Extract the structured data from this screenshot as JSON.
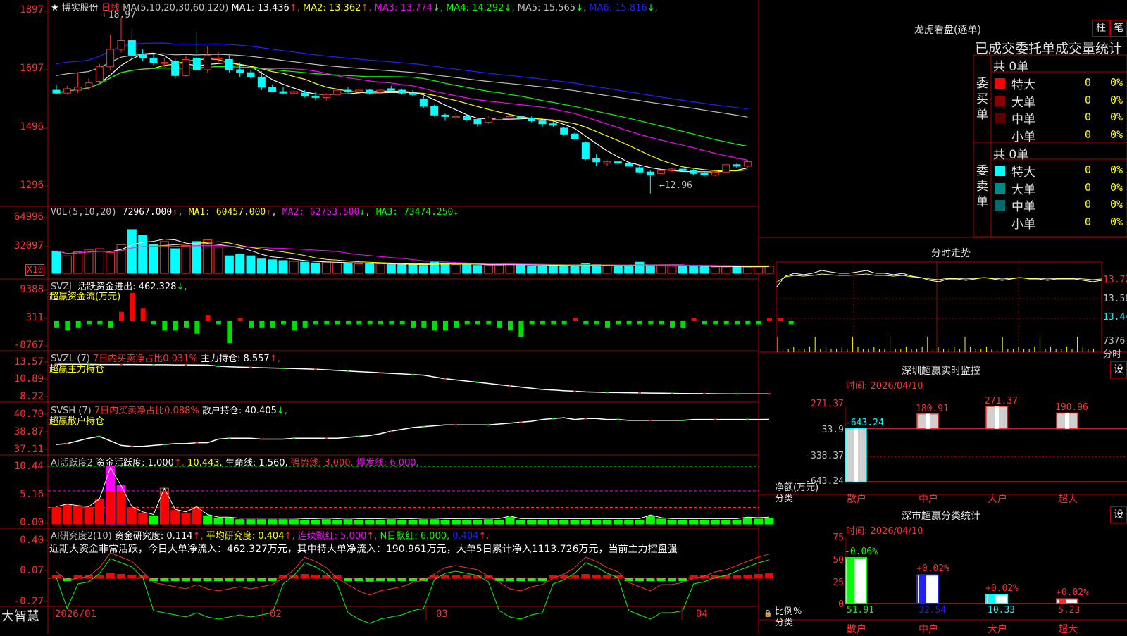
{
  "stock": {
    "name": "博实股份",
    "period": "日线",
    "ma_params": "MA(5,10,20,30,60,120)",
    "ma_values": [
      {
        "label": "MA1: 13.436",
        "arrow": "↑",
        "color": "#ffffff"
      },
      {
        "label": "MA2: 13.362",
        "arrow": "↑",
        "color": "#ffff00"
      },
      {
        "label": "MA3: 13.774",
        "arrow": "↓",
        "color": "#ff00ff"
      },
      {
        "label": "MA4: 14.292",
        "arrow": "↓",
        "color": "#00ff00"
      },
      {
        "label": "MA5: 15.565",
        "arrow": "↓",
        "color": "#c0c0c0"
      },
      {
        "label": "MA6: 15.816",
        "arrow": "↓",
        "color": "#2020ff"
      }
    ],
    "high_mark": "18.97",
    "low_mark": "12.96",
    "price_axis": [
      "1897",
      "1697",
      "1496",
      "1296"
    ]
  },
  "chart_data": [
    {
      "type": "candlestick",
      "title": "日线",
      "ylim": [
        12.5,
        19.2
      ],
      "candles": [
        {
          "o": 16.5,
          "h": 16.7,
          "l": 16.4,
          "c": 16.4
        },
        {
          "o": 16.4,
          "h": 16.65,
          "l": 16.35,
          "c": 16.55
        },
        {
          "o": 16.5,
          "h": 17.1,
          "l": 16.4,
          "c": 16.6
        },
        {
          "o": 16.6,
          "h": 16.9,
          "l": 16.5,
          "c": 16.75
        },
        {
          "o": 16.8,
          "h": 17.4,
          "l": 16.7,
          "c": 17.3
        },
        {
          "o": 17.3,
          "h": 18.4,
          "l": 17.2,
          "c": 17.9
        },
        {
          "o": 17.9,
          "h": 18.97,
          "l": 17.8,
          "c": 18.2
        },
        {
          "o": 18.2,
          "h": 18.6,
          "l": 17.6,
          "c": 17.7
        },
        {
          "o": 17.7,
          "h": 17.9,
          "l": 17.5,
          "c": 17.6
        },
        {
          "o": 17.6,
          "h": 17.75,
          "l": 17.35,
          "c": 17.45
        },
        {
          "o": 17.45,
          "h": 17.6,
          "l": 17.3,
          "c": 17.45
        },
        {
          "o": 17.5,
          "h": 17.6,
          "l": 16.9,
          "c": 17.0
        },
        {
          "o": 17.0,
          "h": 17.7,
          "l": 16.95,
          "c": 17.55
        },
        {
          "o": 17.6,
          "h": 18.5,
          "l": 17.5,
          "c": 17.2
        },
        {
          "o": 17.2,
          "h": 18.0,
          "l": 17.1,
          "c": 17.7
        },
        {
          "o": 17.6,
          "h": 17.8,
          "l": 17.4,
          "c": 17.6
        },
        {
          "o": 17.55,
          "h": 17.7,
          "l": 17.1,
          "c": 17.2
        },
        {
          "o": 17.2,
          "h": 17.45,
          "l": 16.95,
          "c": 17.1
        },
        {
          "o": 17.1,
          "h": 17.2,
          "l": 16.9,
          "c": 16.95
        },
        {
          "o": 16.95,
          "h": 17.15,
          "l": 16.5,
          "c": 16.6
        },
        {
          "o": 16.6,
          "h": 16.7,
          "l": 16.45,
          "c": 16.45
        },
        {
          "o": 16.45,
          "h": 16.6,
          "l": 16.35,
          "c": 16.4
        },
        {
          "o": 16.4,
          "h": 16.55,
          "l": 16.35,
          "c": 16.45
        },
        {
          "o": 16.4,
          "h": 16.5,
          "l": 16.25,
          "c": 16.3
        },
        {
          "o": 16.3,
          "h": 16.45,
          "l": 16.15,
          "c": 16.25
        },
        {
          "o": 16.25,
          "h": 16.4,
          "l": 16.15,
          "c": 16.35
        },
        {
          "o": 16.35,
          "h": 16.55,
          "l": 16.3,
          "c": 16.5
        },
        {
          "o": 16.5,
          "h": 16.6,
          "l": 16.4,
          "c": 16.45
        },
        {
          "o": 16.45,
          "h": 16.6,
          "l": 16.4,
          "c": 16.5
        },
        {
          "o": 16.5,
          "h": 16.55,
          "l": 16.35,
          "c": 16.4
        },
        {
          "o": 16.45,
          "h": 16.55,
          "l": 16.4,
          "c": 16.5
        },
        {
          "o": 16.55,
          "h": 16.65,
          "l": 16.45,
          "c": 16.5
        },
        {
          "o": 16.5,
          "h": 16.55,
          "l": 16.35,
          "c": 16.4
        },
        {
          "o": 16.4,
          "h": 16.5,
          "l": 16.3,
          "c": 16.35
        },
        {
          "o": 16.2,
          "h": 16.3,
          "l": 15.9,
          "c": 15.95
        },
        {
          "o": 15.95,
          "h": 16.0,
          "l": 15.6,
          "c": 15.65
        },
        {
          "o": 15.65,
          "h": 15.7,
          "l": 15.45,
          "c": 15.6
        },
        {
          "o": 15.6,
          "h": 15.7,
          "l": 15.5,
          "c": 15.6
        },
        {
          "o": 15.6,
          "h": 15.65,
          "l": 15.45,
          "c": 15.5
        },
        {
          "o": 15.5,
          "h": 15.55,
          "l": 15.25,
          "c": 15.35
        },
        {
          "o": 15.4,
          "h": 15.6,
          "l": 15.35,
          "c": 15.55
        },
        {
          "o": 15.5,
          "h": 15.6,
          "l": 15.45,
          "c": 15.55
        },
        {
          "o": 15.55,
          "h": 15.65,
          "l": 15.5,
          "c": 15.6
        },
        {
          "o": 15.6,
          "h": 15.65,
          "l": 15.5,
          "c": 15.55
        },
        {
          "o": 15.55,
          "h": 15.6,
          "l": 15.4,
          "c": 15.45
        },
        {
          "o": 15.45,
          "h": 15.5,
          "l": 15.25,
          "c": 15.35
        },
        {
          "o": 15.35,
          "h": 15.45,
          "l": 15.25,
          "c": 15.3
        },
        {
          "o": 15.2,
          "h": 15.25,
          "l": 14.95,
          "c": 15.0
        },
        {
          "o": 15.0,
          "h": 15.05,
          "l": 14.8,
          "c": 14.85
        },
        {
          "o": 14.7,
          "h": 14.75,
          "l": 14.1,
          "c": 14.15
        },
        {
          "o": 14.15,
          "h": 14.3,
          "l": 13.9,
          "c": 14.05
        },
        {
          "o": 14.0,
          "h": 14.1,
          "l": 13.9,
          "c": 14.05
        },
        {
          "o": 14.05,
          "h": 14.1,
          "l": 13.95,
          "c": 14.0
        },
        {
          "o": 14.0,
          "h": 14.05,
          "l": 13.9,
          "c": 13.9
        },
        {
          "o": 13.85,
          "h": 13.9,
          "l": 13.65,
          "c": 13.7
        },
        {
          "o": 13.7,
          "h": 13.75,
          "l": 12.96,
          "c": 13.6
        },
        {
          "o": 13.65,
          "h": 13.8,
          "l": 13.6,
          "c": 13.75
        },
        {
          "o": 13.75,
          "h": 13.85,
          "l": 13.7,
          "c": 13.8
        },
        {
          "o": 13.8,
          "h": 13.85,
          "l": 13.7,
          "c": 13.75
        },
        {
          "o": 13.75,
          "h": 13.8,
          "l": 13.6,
          "c": 13.65
        },
        {
          "o": 13.65,
          "h": 13.7,
          "l": 13.55,
          "c": 13.6
        },
        {
          "o": 13.6,
          "h": 13.75,
          "l": 13.55,
          "c": 13.7
        },
        {
          "o": 13.7,
          "h": 14.0,
          "l": 13.65,
          "c": 13.95
        },
        {
          "o": 13.95,
          "h": 14.0,
          "l": 13.85,
          "c": 13.9
        },
        {
          "o": 13.9,
          "h": 14.1,
          "l": 13.85,
          "c": 14.05
        }
      ]
    },
    {
      "type": "bar",
      "title": "VOL(5,10,20)",
      "series_labels": [
        "72967.000",
        "MA1: 60457.000",
        "MA2: 62753.500",
        "MA3: 73474.250"
      ],
      "values": [
        28,
        22,
        27,
        30,
        31,
        26,
        36,
        55,
        48,
        36,
        40,
        31,
        35,
        40,
        42,
        33,
        22,
        24,
        22,
        18,
        17,
        16,
        15,
        14,
        13,
        14,
        13,
        13,
        12,
        12,
        12,
        11,
        11,
        11,
        10,
        14,
        13,
        11,
        11,
        10,
        10,
        11,
        13,
        10,
        9,
        9,
        10,
        9,
        9,
        12,
        11,
        10,
        9,
        10,
        14,
        10,
        10,
        9,
        9,
        9,
        9,
        8,
        8,
        8,
        8,
        9,
        9
      ],
      "ylim": [
        0,
        70
      ]
    },
    {
      "type": "bar",
      "title": "SVZJ 活跃资金进出",
      "value_label": "462.328",
      "values": [
        -2,
        -3,
        -2,
        -1,
        -1,
        -2,
        3,
        9,
        4,
        -1,
        -3,
        -3,
        -2,
        -4,
        2,
        -1,
        -7,
        1,
        -2,
        -2,
        -2,
        -1,
        -3,
        -2,
        -1,
        -1,
        -1,
        -1,
        -1,
        -1,
        -1,
        -1,
        -1,
        -2,
        -2,
        -3,
        -3,
        -2,
        -1,
        -1,
        -1,
        -2,
        -3,
        -5,
        -1,
        -1,
        -1,
        -1,
        1,
        -1,
        -1,
        -2,
        -1,
        -1,
        -1,
        -1,
        -1,
        -2,
        -2,
        1,
        -1,
        -1,
        -1,
        -1,
        -1,
        -1,
        1,
        1,
        -1
      ],
      "ylim": [
        -9,
        9
      ]
    },
    {
      "type": "line",
      "title": "SVZL (7)",
      "values": [
        13.52,
        13.52,
        13.5,
        13.5,
        13.48,
        13.48,
        13.47,
        13.47,
        13.46,
        13.44,
        13.44,
        13.42,
        13.42,
        13.4,
        13.38,
        13.2,
        13.1,
        13.05,
        13.0,
        12.95,
        12.9,
        12.85,
        12.8,
        12.75,
        12.7,
        12.6,
        12.5,
        12.4,
        12.3,
        12.2,
        12.1,
        12.0,
        11.9,
        11.8,
        11.7,
        11.4,
        11.1,
        10.9,
        10.7,
        10.5,
        10.3,
        10.1,
        9.9,
        9.7,
        9.5,
        9.3,
        9.2,
        9.1,
        9.0,
        8.9,
        8.85,
        8.8,
        8.78,
        8.75,
        8.72,
        8.7,
        8.68,
        8.65,
        8.63,
        8.6,
        8.6,
        8.58,
        8.57,
        8.56,
        8.56,
        8.56,
        8.557
      ],
      "ylim": [
        8.0,
        13.9
      ]
    },
    {
      "type": "line",
      "title": "SVSH (7)",
      "values": [
        37.6,
        37.7,
        38.0,
        38.3,
        38.5,
        38.0,
        37.5,
        37.4,
        37.4,
        37.5,
        37.6,
        37.7,
        37.7,
        37.8,
        37.8,
        38.2,
        38.3,
        38.3,
        38.3,
        38.2,
        38.2,
        38.2,
        38.3,
        38.3,
        38.3,
        38.3,
        38.3,
        38.4,
        38.5,
        38.6,
        38.8,
        39.1,
        39.3,
        39.5,
        39.6,
        39.7,
        39.8,
        39.8,
        39.8,
        39.8,
        39.8,
        39.9,
        40.0,
        40.1,
        40.2,
        40.4,
        40.5,
        40.6,
        40.4,
        40.5,
        40.5,
        40.4,
        40.4,
        40.3,
        40.3,
        40.3,
        40.3,
        40.3,
        40.3,
        40.4,
        40.4,
        40.4,
        40.4,
        40.4,
        40.4,
        40.4,
        40.405
      ],
      "ylim": [
        36.9,
        41.0
      ]
    },
    {
      "type": "bar",
      "title": "AI活跃度2",
      "values": [
        3.0,
        3.5,
        3.2,
        3.0,
        4.5,
        10.44,
        7.0,
        3.0,
        2.0,
        1.5,
        6.5,
        2.5,
        2.0,
        3.0,
        1.5,
        1.0,
        1.0,
        0.8,
        0.8,
        0.8,
        0.8,
        0.8,
        0.8,
        0.7,
        0.7,
        0.8,
        0.7,
        0.8,
        0.7,
        0.7,
        0.7,
        0.8,
        0.7,
        0.7,
        0.8,
        0.8,
        0.7,
        0.7,
        0.7,
        0.7,
        0.8,
        0.7,
        1.2,
        0.7,
        0.7,
        0.7,
        0.7,
        0.7,
        0.7,
        0.7,
        0.7,
        0.7,
        0.7,
        0.7,
        0.7,
        1.4,
        0.9,
        0.7,
        0.7,
        0.7,
        0.7,
        0.7,
        0.7,
        0.7,
        1.0,
        0.9,
        1.0
      ],
      "ylim": [
        0,
        11.5
      ]
    },
    {
      "type": "bar",
      "title": "AI研究度2(10)",
      "values": [
        0.03,
        -0.01,
        0.0,
        0.01,
        0.05,
        0.12,
        0.1,
        0.08,
        0.03,
        -0.02,
        -0.03,
        -0.04,
        -0.05,
        -0.03,
        -0.05,
        -0.06,
        -0.05,
        -0.04,
        -0.05,
        -0.04,
        -0.03,
        0.0,
        0.04,
        0.1,
        0.08,
        0.05,
        0.0,
        -0.03,
        -0.06,
        -0.08,
        -0.06,
        -0.05,
        -0.04,
        -0.02,
        -0.01,
        0.02,
        0.05,
        0.06,
        0.05,
        0.04,
        0.01,
        -0.02,
        -0.05,
        -0.06,
        -0.04,
        -0.03,
        0.0,
        0.02,
        0.05,
        0.1,
        0.08,
        0.05,
        0.03,
        -0.02,
        -0.04,
        -0.06,
        -0.03,
        -0.03,
        -0.02,
        0.0,
        0.01,
        0.03,
        0.04,
        0.06,
        0.08,
        0.1,
        0.114
      ],
      "ylim": [
        -0.3,
        0.45
      ]
    },
    {
      "type": "line",
      "title": "分时走势",
      "values": [
        13.6,
        13.68,
        13.7,
        13.69,
        13.7,
        13.72,
        13.71,
        13.7,
        13.7,
        13.71,
        13.72,
        13.7,
        13.7,
        13.69,
        13.7,
        13.68,
        13.67,
        13.65,
        13.64,
        13.66,
        13.66,
        13.65,
        13.66,
        13.67,
        13.66,
        13.65,
        13.66,
        13.67,
        13.66,
        13.66,
        13.65,
        13.66,
        13.66,
        13.66,
        13.65,
        13.64,
        13.65
      ],
      "ylim": [
        13.38,
        13.78
      ]
    },
    {
      "type": "bar",
      "title": "深圳超赢实时监控",
      "categories": [
        "散户",
        "中户",
        "大户",
        "超大"
      ],
      "values": [
        -643.24,
        180.91,
        271.37,
        190.96
      ],
      "ylim": [
        -643.24,
        271.37
      ]
    },
    {
      "type": "bar",
      "title": "深市超赢分类统计",
      "categories": [
        "散户",
        "中户",
        "大户",
        "超大"
      ],
      "values": [
        51.91,
        32.54,
        10.33,
        5.23
      ],
      "changes": [
        "-0.06%",
        "+0.02%",
        "+0.02%",
        "+0.02%"
      ],
      "ylim": [
        0,
        75
      ]
    }
  ],
  "vol": {
    "params": "VOL(5,10,20)",
    "v": "72967.000",
    "v_arrow": "↑",
    "ma1": "MA1: 60457.000",
    "ma1_arrow": "↑",
    "ma2": "MA2: 62753.500",
    "ma2_arrow": "↓",
    "ma3": "MA3: 73474.250",
    "ma3_arrow": "↓",
    "axis": [
      "64996",
      "32097"
    ],
    "unit": "X10"
  },
  "svzj": {
    "title": "SVZJ",
    "label": "活跃资金进出: 462.328",
    "arrow": "↓",
    "sub": "超赢资金流(万元)",
    "axis": [
      "9388",
      "311",
      "-8767"
    ]
  },
  "svzl": {
    "title": "SVZL (7)",
    "red_label": "7日内买卖净占比0.031%",
    "label": "主力持仓: 8.557",
    "arrow": "↑,",
    "sub": "超赢主力持仓",
    "axis": [
      "13.57",
      "10.89",
      "8.22"
    ]
  },
  "svsh": {
    "title": "SVSH (7)",
    "red_label": "7日内买卖净占比0.088%",
    "label": "散户持仓: 40.405",
    "arrow": "↓,",
    "sub": "超赢散户持仓",
    "axis": [
      "40.70",
      "38.87",
      "37.11"
    ]
  },
  "ai_active": {
    "title": "AI活跃度2",
    "label1": "资金活跃度: 1.000",
    "a1": "↑,",
    "label2": "10.443,",
    "label3": "生命线: 1.560,",
    "label4": "强势线: 3.000,",
    "label5": "爆发线: 6.000,",
    "axis": [
      "10.44",
      "5.16",
      "0.00"
    ]
  },
  "ai_research": {
    "title": "AI研究度2(10)",
    "label1": "资金研究度: 0.114",
    "a1": "↑,",
    "label2": "平均研究度: 0.404",
    "a2": "↑,",
    "label3": "连续飘红: 5.000",
    "a3": "↑,",
    "label4": "N日飘红: 6.000,",
    "label5": "0.404",
    "a5": "↑.",
    "comment": "近期大资金非常活跃，今日大单净流入：462.327万元，其中特大单净流入：190.961万元，大单5日累计净入1113.726万元，当前主力控盘强",
    "axis": [
      "0.40",
      "0.07",
      "-0.27"
    ]
  },
  "date_axis": {
    "labels": [
      "2026/01",
      "02",
      "03",
      "04"
    ]
  },
  "brand": "大智慧",
  "lhb": {
    "title": "龙虎看盘(逐单)",
    "btn1": "柱",
    "btn2": "笔",
    "tabs": "已成交委托单成交量统计",
    "buy_label": "委买单",
    "sell_label": "委卖单",
    "buy_total": "共 0单",
    "sell_total": "共 0单",
    "buy_rows": [
      {
        "name": "特大",
        "v": "0",
        "p": "0%",
        "color": "#ff0000"
      },
      {
        "name": "大单",
        "v": "0",
        "p": "0%",
        "color": "#8b0000"
      },
      {
        "name": "中单",
        "v": "0",
        "p": "0%",
        "color": "#5a0000"
      },
      {
        "name": "小单",
        "v": "0",
        "p": "0%",
        "color": "#000000"
      }
    ],
    "sell_rows": [
      {
        "name": "特大",
        "v": "0",
        "p": "0%",
        "color": "#00ffff"
      },
      {
        "name": "大单",
        "v": "0",
        "p": "0%",
        "color": "#008b8b"
      },
      {
        "name": "中单",
        "v": "0",
        "p": "0%",
        "color": "#006b6b"
      },
      {
        "name": "小单",
        "v": "0",
        "p": "0%",
        "color": "#000000"
      }
    ]
  },
  "fenshi": {
    "title": "分时走势",
    "axis": [
      "13.72",
      "13.58",
      "13.44",
      "7376"
    ],
    "unit": "分时"
  },
  "monitor": {
    "title": "深圳超赢实时监控",
    "btn": "设",
    "time": "时间: 2026/04/10",
    "axis": [
      "271.37",
      "-33.9",
      "-338.37",
      "-643.24"
    ],
    "ylabel": "净额(万元)",
    "xlabel": "分类",
    "bar_labels": [
      "-643.24",
      "180.91",
      "271.37",
      "190.96"
    ],
    "categories": [
      "散户",
      "中户",
      "大户",
      "超大"
    ]
  },
  "stats": {
    "title": "深市超赢分类统计",
    "btn": "设",
    "time": "时间: 2026/04/10",
    "axis": [
      "75",
      "50",
      "25",
      "0"
    ],
    "ylabel": "比例%",
    "xlabel": "分类",
    "changes": [
      "-0.06%",
      "+0.02%",
      "+0.02%",
      "+0.02%"
    ],
    "values": [
      "51.91",
      "32.54",
      "10.33",
      "5.23"
    ],
    "categories": [
      "散户",
      "中户",
      "大户",
      "超大"
    ]
  }
}
